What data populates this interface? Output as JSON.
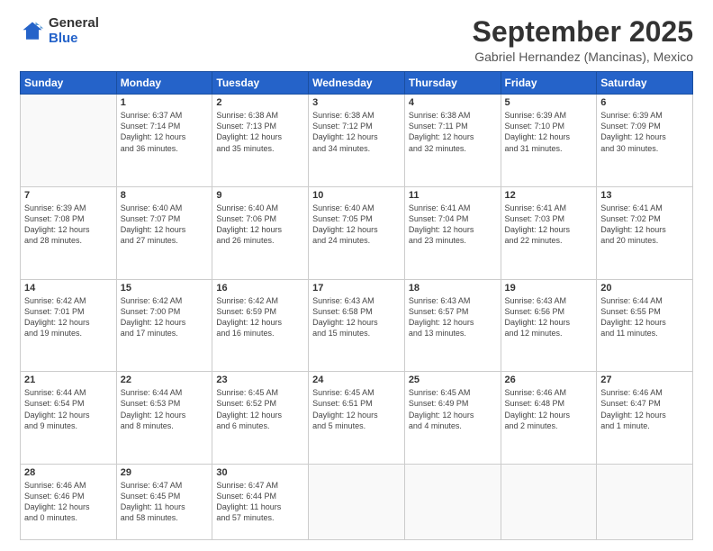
{
  "header": {
    "logo_general": "General",
    "logo_blue": "Blue",
    "title": "September 2025",
    "location": "Gabriel Hernandez (Mancinas), Mexico"
  },
  "weekdays": [
    "Sunday",
    "Monday",
    "Tuesday",
    "Wednesday",
    "Thursday",
    "Friday",
    "Saturday"
  ],
  "weeks": [
    [
      {
        "day": "",
        "info": ""
      },
      {
        "day": "1",
        "info": "Sunrise: 6:37 AM\nSunset: 7:14 PM\nDaylight: 12 hours\nand 36 minutes."
      },
      {
        "day": "2",
        "info": "Sunrise: 6:38 AM\nSunset: 7:13 PM\nDaylight: 12 hours\nand 35 minutes."
      },
      {
        "day": "3",
        "info": "Sunrise: 6:38 AM\nSunset: 7:12 PM\nDaylight: 12 hours\nand 34 minutes."
      },
      {
        "day": "4",
        "info": "Sunrise: 6:38 AM\nSunset: 7:11 PM\nDaylight: 12 hours\nand 32 minutes."
      },
      {
        "day": "5",
        "info": "Sunrise: 6:39 AM\nSunset: 7:10 PM\nDaylight: 12 hours\nand 31 minutes."
      },
      {
        "day": "6",
        "info": "Sunrise: 6:39 AM\nSunset: 7:09 PM\nDaylight: 12 hours\nand 30 minutes."
      }
    ],
    [
      {
        "day": "7",
        "info": "Sunrise: 6:39 AM\nSunset: 7:08 PM\nDaylight: 12 hours\nand 28 minutes."
      },
      {
        "day": "8",
        "info": "Sunrise: 6:40 AM\nSunset: 7:07 PM\nDaylight: 12 hours\nand 27 minutes."
      },
      {
        "day": "9",
        "info": "Sunrise: 6:40 AM\nSunset: 7:06 PM\nDaylight: 12 hours\nand 26 minutes."
      },
      {
        "day": "10",
        "info": "Sunrise: 6:40 AM\nSunset: 7:05 PM\nDaylight: 12 hours\nand 24 minutes."
      },
      {
        "day": "11",
        "info": "Sunrise: 6:41 AM\nSunset: 7:04 PM\nDaylight: 12 hours\nand 23 minutes."
      },
      {
        "day": "12",
        "info": "Sunrise: 6:41 AM\nSunset: 7:03 PM\nDaylight: 12 hours\nand 22 minutes."
      },
      {
        "day": "13",
        "info": "Sunrise: 6:41 AM\nSunset: 7:02 PM\nDaylight: 12 hours\nand 20 minutes."
      }
    ],
    [
      {
        "day": "14",
        "info": "Sunrise: 6:42 AM\nSunset: 7:01 PM\nDaylight: 12 hours\nand 19 minutes."
      },
      {
        "day": "15",
        "info": "Sunrise: 6:42 AM\nSunset: 7:00 PM\nDaylight: 12 hours\nand 17 minutes."
      },
      {
        "day": "16",
        "info": "Sunrise: 6:42 AM\nSunset: 6:59 PM\nDaylight: 12 hours\nand 16 minutes."
      },
      {
        "day": "17",
        "info": "Sunrise: 6:43 AM\nSunset: 6:58 PM\nDaylight: 12 hours\nand 15 minutes."
      },
      {
        "day": "18",
        "info": "Sunrise: 6:43 AM\nSunset: 6:57 PM\nDaylight: 12 hours\nand 13 minutes."
      },
      {
        "day": "19",
        "info": "Sunrise: 6:43 AM\nSunset: 6:56 PM\nDaylight: 12 hours\nand 12 minutes."
      },
      {
        "day": "20",
        "info": "Sunrise: 6:44 AM\nSunset: 6:55 PM\nDaylight: 12 hours\nand 11 minutes."
      }
    ],
    [
      {
        "day": "21",
        "info": "Sunrise: 6:44 AM\nSunset: 6:54 PM\nDaylight: 12 hours\nand 9 minutes."
      },
      {
        "day": "22",
        "info": "Sunrise: 6:44 AM\nSunset: 6:53 PM\nDaylight: 12 hours\nand 8 minutes."
      },
      {
        "day": "23",
        "info": "Sunrise: 6:45 AM\nSunset: 6:52 PM\nDaylight: 12 hours\nand 6 minutes."
      },
      {
        "day": "24",
        "info": "Sunrise: 6:45 AM\nSunset: 6:51 PM\nDaylight: 12 hours\nand 5 minutes."
      },
      {
        "day": "25",
        "info": "Sunrise: 6:45 AM\nSunset: 6:49 PM\nDaylight: 12 hours\nand 4 minutes."
      },
      {
        "day": "26",
        "info": "Sunrise: 6:46 AM\nSunset: 6:48 PM\nDaylight: 12 hours\nand 2 minutes."
      },
      {
        "day": "27",
        "info": "Sunrise: 6:46 AM\nSunset: 6:47 PM\nDaylight: 12 hours\nand 1 minute."
      }
    ],
    [
      {
        "day": "28",
        "info": "Sunrise: 6:46 AM\nSunset: 6:46 PM\nDaylight: 12 hours\nand 0 minutes."
      },
      {
        "day": "29",
        "info": "Sunrise: 6:47 AM\nSunset: 6:45 PM\nDaylight: 11 hours\nand 58 minutes."
      },
      {
        "day": "30",
        "info": "Sunrise: 6:47 AM\nSunset: 6:44 PM\nDaylight: 11 hours\nand 57 minutes."
      },
      {
        "day": "",
        "info": ""
      },
      {
        "day": "",
        "info": ""
      },
      {
        "day": "",
        "info": ""
      },
      {
        "day": "",
        "info": ""
      }
    ]
  ]
}
